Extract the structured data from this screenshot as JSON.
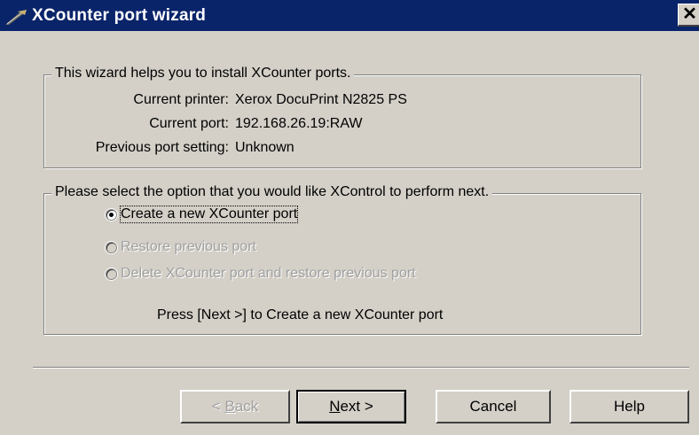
{
  "window": {
    "title": "XCounter port wizard",
    "close_label": "✕"
  },
  "info_group": {
    "legend": "This wizard helps you to install XCounter ports.",
    "printer_label": "Current printer:",
    "printer_value": "Xerox DocuPrint N2825 PS",
    "port_label": "Current port:",
    "port_value": "192.168.26.19:RAW",
    "prev_label": "Previous port setting:",
    "prev_value": "Unknown"
  },
  "options_group": {
    "legend": "Please select the option that you would like XControl to perform next.",
    "options": [
      {
        "label": "Create a new XCounter port",
        "checked": true,
        "enabled": true
      },
      {
        "label": "Restore previous port",
        "checked": false,
        "enabled": false
      },
      {
        "label": "Delete XCounter port and restore previous port",
        "checked": false,
        "enabled": false
      }
    ],
    "hint": "Press [Next >] to Create a new XCounter port"
  },
  "buttons": {
    "back_prefix": "< ",
    "back_ul": "B",
    "back_rest": "ack",
    "next_ul": "N",
    "next_rest": "ext >",
    "cancel": "Cancel",
    "help": "Help"
  },
  "colors": {
    "title_bar": "#0a246a",
    "dialog_bg": "#d4d0c8",
    "disabled_text": "#a0a0a0"
  }
}
